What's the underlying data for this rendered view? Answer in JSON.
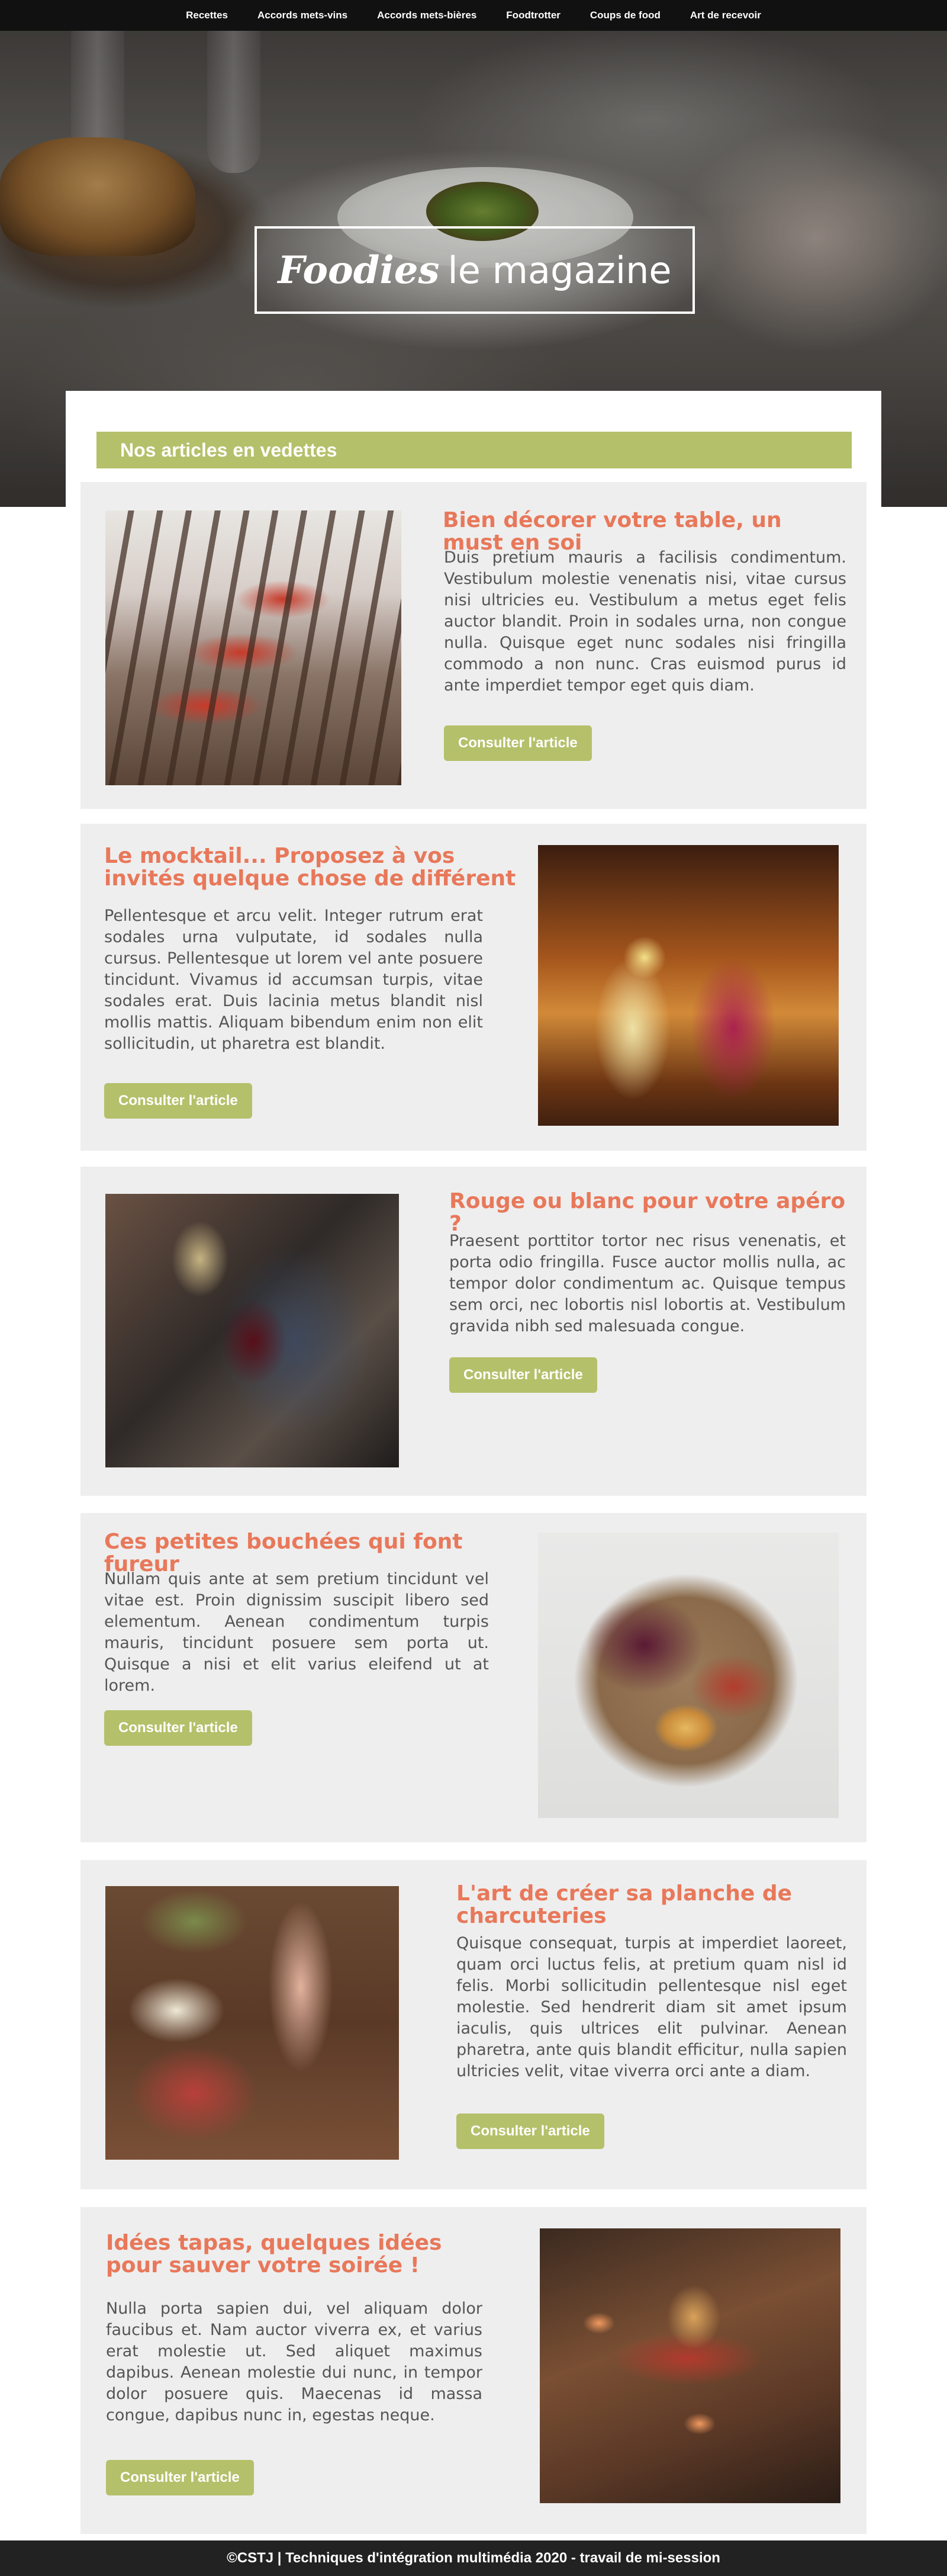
{
  "nav": {
    "items": [
      {
        "label": "Recettes"
      },
      {
        "label": "Accords mets-vins"
      },
      {
        "label": "Accords mets-bières"
      },
      {
        "label": "Foodtrotter"
      },
      {
        "label": "Coups de food"
      },
      {
        "label": "Art de recevoir"
      }
    ]
  },
  "hero": {
    "title_script": "Foodies",
    "title_rest": "le magazine"
  },
  "featured": {
    "heading": "Nos articles en vedettes"
  },
  "articles": [
    {
      "title": "Bien décorer votre table, un must en soi",
      "text": "Duis pretium mauris a facilisis condimentum. Vestibulum molestie venenatis nisi, vitae cursus nisi ultricies eu. Vestibulum a metus eget felis auctor blandit. Proin in sodales urna, non congue nulla. Quisque eget nunc sodales nisi fringilla commodo a non nunc. Cras euismod purus id ante imperdiet tempor eget quis diam.",
      "button": "Consulter l'article"
    },
    {
      "title": "Le mocktail... Proposez à vos invités quelque chose de différent",
      "text": "Pellentesque et arcu velit. Integer rutrum erat sodales urna vulputate, id sodales nulla cursus. Pellentesque ut lorem vel ante posuere tincidunt. Vivamus id accumsan turpis, vitae sodales erat. Duis lacinia metus blandit nisl mollis mattis. Aliquam bibendum enim non elit sollicitudin, ut pharetra est blandit.",
      "button": "Consulter l'article"
    },
    {
      "title": "Rouge ou blanc pour votre apéro ?",
      "text": "Praesent porttitor tortor nec risus venenatis, et porta odio fringilla. Fusce auctor mollis nulla, ac tempor dolor condimentum ac. Quisque tempus sem orci, nec lobortis nisl lobortis at. Vestibulum gravida nibh sed malesuada congue.",
      "button": "Consulter l'article"
    },
    {
      "title": "Ces petites bouchées qui font fureur",
      "text": "Nullam quis ante at sem pretium tincidunt vel vitae est. Proin dignissim suscipit libero sed elementum. Aenean condimentum turpis mauris, tincidunt posuere sem porta ut. Quisque a nisi et elit varius eleifend ut at lorem.",
      "button": "Consulter l'article"
    },
    {
      "title": "L'art de créer sa planche de charcuteries",
      "text": "Quisque consequat, turpis at imperdiet laoreet, quam orci luctus felis, at pretium quam nisl id felis. Morbi sollicitudin pellentesque nisl eget molestie. Sed hendrerit diam sit amet ipsum iaculis, quis ultrices elit pulvinar. Aenean pharetra, ante quis blandit efficitur, nulla sapien ultricies velit, vitae viverra orci ante a diam.",
      "button": "Consulter l'article"
    },
    {
      "title": "Idées tapas, quelques idées pour sauver votre soirée !",
      "text": "Nulla porta sapien dui, vel aliquam dolor faucibus et. Nam auctor viverra ex, et varius erat molestie ut. Sed aliquet maximus dapibus. Aenean molestie dui nunc, in tempor dolor posuere quis. Maecenas id massa congue, dapibus nunc in, egestas neque.",
      "button": "Consulter l'article"
    }
  ],
  "footer": {
    "text": "©CSTJ | Techniques d'intégration multimédia 2020 - travail de mi-session"
  }
}
